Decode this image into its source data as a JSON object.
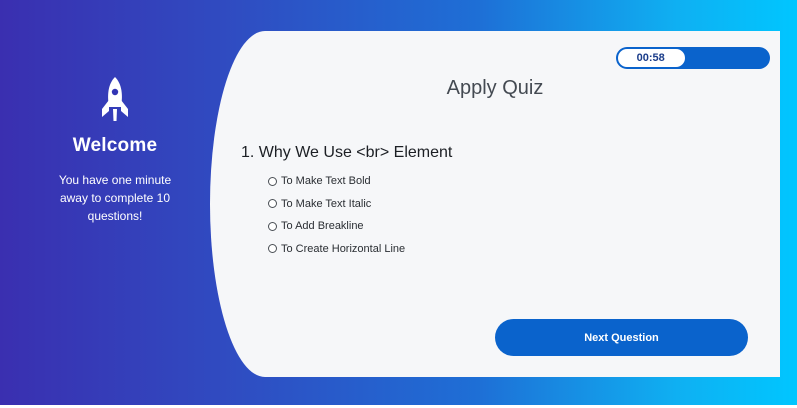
{
  "welcome": {
    "icon": "rocket-icon",
    "title": "Welcome",
    "message": "You have one minute away to complete 10 questions!"
  },
  "timer": {
    "value": "00:58",
    "progress_fraction": 0.45
  },
  "quiz": {
    "title": "Apply Quiz",
    "question": "1. Why We Use <br> Element",
    "options": [
      "To Make Text Bold",
      "To Make Text Italic",
      "To Add Breakline",
      "To Create Horizontal Line"
    ],
    "next_label": "Next Question"
  },
  "colors": {
    "accent": "#0a63cc",
    "gradient_start": "#3a2fb0",
    "gradient_end": "#00c6ff",
    "card": "#f6f7f9"
  }
}
